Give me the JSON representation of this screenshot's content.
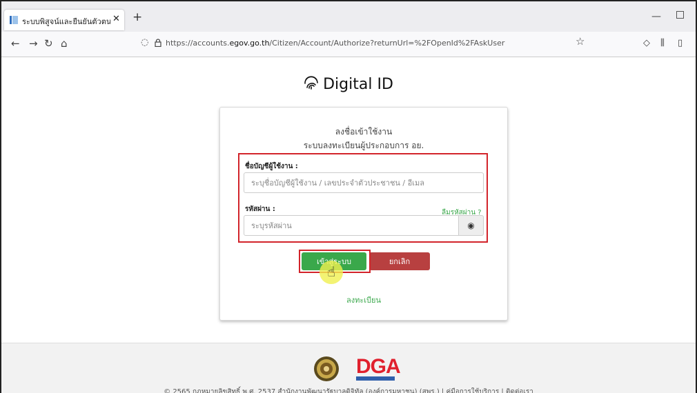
{
  "browser": {
    "tab_title": "ระบบพิสูจน์และยืนยันตัวตนทางดิจิ",
    "url_prefix": "https://accounts.",
    "url_domain": "egov.go.th",
    "url_path": "/Citizen/Account/Authorize?returnUrl=%2FOpenId%2FAskUser"
  },
  "page": {
    "logo_text": "Digital ID",
    "card_title": "ลงชื่อเข้าใช้งาน",
    "card_subtitle": "ระบบลงทะเบียนผู้ประกอบการ อย.",
    "username_label": "ชื่อบัญชีผู้ใช้งาน :",
    "username_placeholder": "ระบุชื่อบัญชีผู้ใช้งาน / เลขประจำตัวประชาชน / อีเมล",
    "password_label": "รหัสผ่าน :",
    "forgot_password": "ลืมรหัสผ่าน ?",
    "password_placeholder": "ระบุรหัสผ่าน",
    "login_button": "เข้าสู่ระบบ",
    "cancel_button": "ยกเลิก",
    "register_link": "ลงทะเบียน"
  },
  "footer": {
    "dga_logo": "DGA",
    "copyright": "© 2565 กฎหมายลิขสิทธิ์ พ.ศ. 2537 สำนักงานพัฒนารัฐบาลดิจิทัล (องค์การมหาชน) (สพร.) | คู่มือการใช้บริการ | ติดต่อเรา"
  },
  "colors": {
    "accent_green": "#3aa84b",
    "cancel_red": "#b84040",
    "highlight_red": "#d2232a",
    "dga_red": "#e0202d"
  }
}
